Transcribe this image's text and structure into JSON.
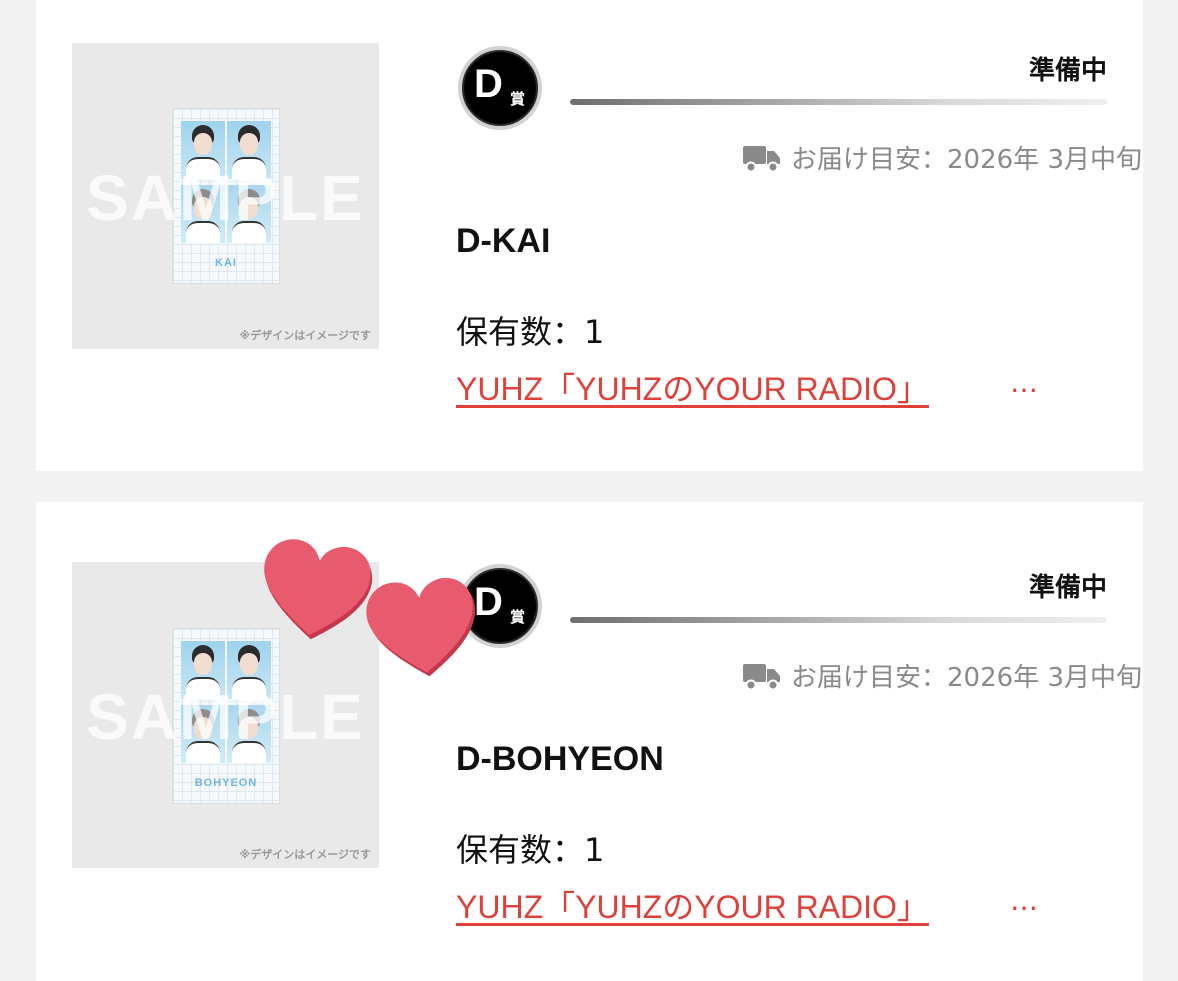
{
  "prizes": [
    {
      "thumbnail": {
        "watermark": "SAMPLE",
        "disclaimer": "※デザインはイメージです",
        "card_name": "KAI"
      },
      "grade_letter": "D",
      "grade_suffix": "賞",
      "status": "準備中",
      "delivery_icon": "truck-icon",
      "delivery": "お届け目安：2026年 3月中旬",
      "name": "D-KAI",
      "count": "保有数：1",
      "link": "YUHZ「YUHZのYOUR RADIO」",
      "link_ellipsis": "…"
    },
    {
      "thumbnail": {
        "watermark": "SAMPLE",
        "disclaimer": "※デザインはイメージです",
        "card_name": "BOHYEON"
      },
      "grade_letter": "D",
      "grade_suffix": "賞",
      "status": "準備中",
      "delivery_icon": "truck-icon",
      "delivery": "お届け目安：2026年 3月中旬",
      "name": "D-BOHYEON",
      "count": "保有数：1",
      "link": "YUHZ「YUHZのYOUR RADIO」",
      "link_ellipsis": "…"
    }
  ],
  "decoration": {
    "icon": "heart-icon",
    "color": "#e85a6e"
  },
  "colors": {
    "link": "#e0403a",
    "muted": "#8a8a8a",
    "background": "#f2f2f2"
  }
}
